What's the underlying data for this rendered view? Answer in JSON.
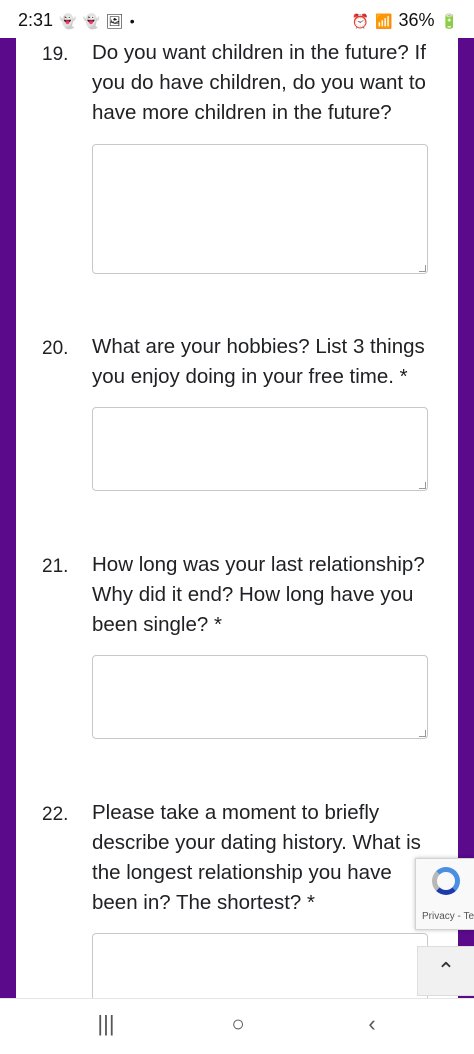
{
  "status_bar": {
    "time": "2:31",
    "notif_icons": [
      "snapchat-icon",
      "snapchat-icon",
      "image-icon",
      "dot-icon"
    ],
    "battery": "36%"
  },
  "questions": [
    {
      "number": "19.",
      "text": "Do you want children in the future? If you do have children, do you want to have more children in the future?"
    },
    {
      "number": "20.",
      "text": "What are your hobbies? List 3 things you enjoy doing in your free time. *"
    },
    {
      "number": "21.",
      "text": "How long was your last relationship? Why did it end? How long have you been single? *"
    },
    {
      "number": "22.",
      "text": "Please take a moment to briefly describe your dating history. What is the longest relationship you have been in? The shortest? *"
    }
  ],
  "recaptcha": {
    "text": "Privacy - Te"
  },
  "scroll_top": {
    "icon": "chevron-up-icon",
    "glyph": "⌃"
  },
  "nav": {
    "recent": "|||",
    "home": "○",
    "back": "‹"
  },
  "colors": {
    "frame": "#5a0a8a",
    "text": "#202124"
  }
}
